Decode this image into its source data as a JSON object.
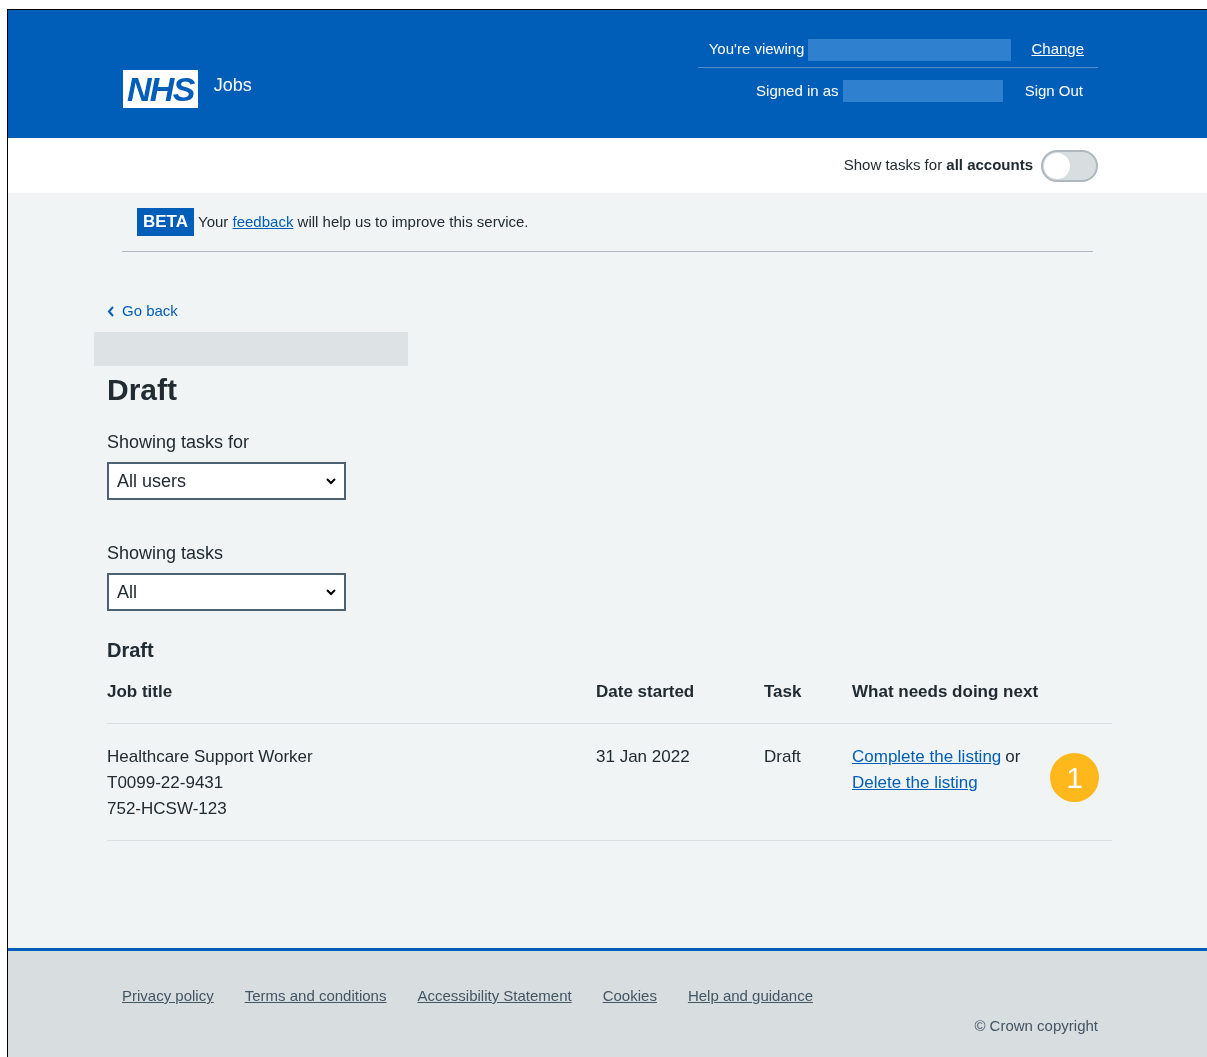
{
  "header": {
    "logo": "NHS",
    "service": "Jobs",
    "viewing_label": "You're viewing",
    "change_link": "Change",
    "signed_in_label": "Signed in as",
    "sign_out_link": "Sign Out"
  },
  "account_toggle": {
    "label": "Show tasks for **all accounts**",
    "on": false
  },
  "beta_banner": {
    "tag": "BETA",
    "before": "Your",
    "link": "feedback",
    "after": "will help us to improve this service."
  },
  "back_link": "Go back",
  "heading": "Draft",
  "filters": [
    {
      "label": "Showing tasks for",
      "value": "All users"
    },
    {
      "label": "Showing tasks",
      "value": "All"
    }
  ],
  "table": {
    "caption": "Draft",
    "columns": [
      "Job title",
      "Date started",
      "Task",
      "What needs doing next"
    ],
    "rows": [
      {
        "job_lines": [
          "Healthcare Support Worker",
          "T0099-22-9431",
          "752-HCSW-123"
        ],
        "date_started": "31 Jan 2022",
        "task": "Draft",
        "action_links": [
          "Complete the listing",
          "Delete the listing"
        ],
        "joiner": "or",
        "callout": "1"
      }
    ]
  },
  "footer": {
    "links": [
      "Privacy policy",
      "Terms and conditions",
      "Accessibility Statement",
      "Cookies",
      "Help and guidance"
    ],
    "copyright": "© Crown copyright"
  }
}
